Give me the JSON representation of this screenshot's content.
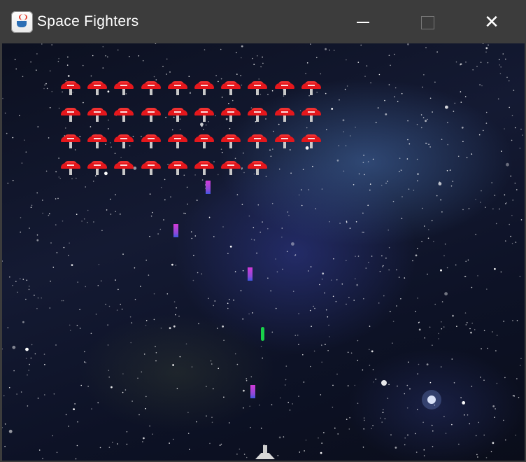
{
  "window": {
    "title": "Space Fighters",
    "app_icon": "java-cup-icon",
    "controls": [
      "minimize-icon",
      "maximize-icon",
      "close-icon"
    ]
  },
  "game": {
    "enemy_formation": {
      "row_counts": [
        10,
        10,
        10,
        8
      ],
      "color": "#e4171c"
    },
    "enemy_bombs": 4,
    "player_shots": 1,
    "bomb_color": "#c83ad8",
    "shot_color": "#19d14a"
  }
}
